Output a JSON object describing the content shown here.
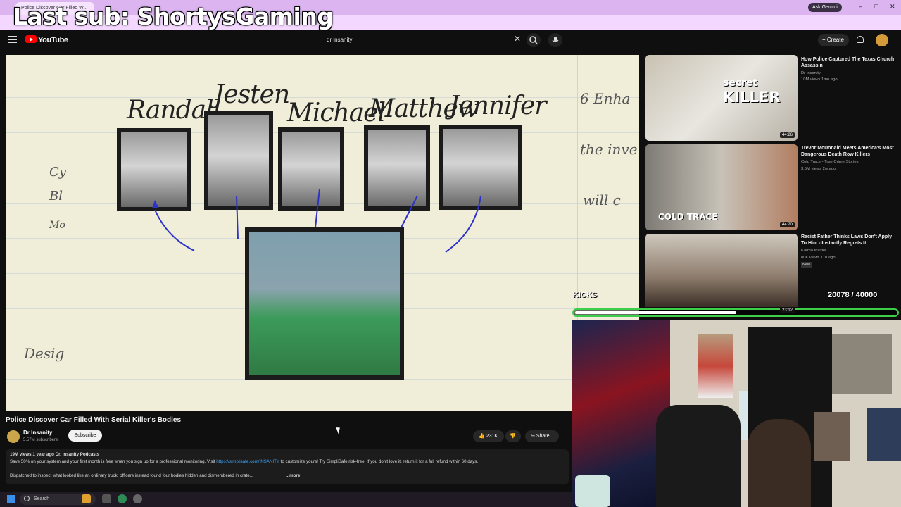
{
  "stream_overlay": {
    "last_sub": "Last sub: ShortysGaming",
    "kicks_label": "KICKS",
    "kicks_count": "20078 / 40000",
    "kicks_progress": 0.502
  },
  "browser": {
    "active_tab": "Police Discover Car Filled W...",
    "ask_gemini": "Ask Gemini"
  },
  "masthead": {
    "logo_text": "YouTube",
    "search_query": "dr insanity",
    "create_label": "Create"
  },
  "video": {
    "names": [
      "Randall",
      "Jesten",
      "Michael",
      "Matthew",
      "Jennifer"
    ],
    "side_text": [
      "6 Enha",
      "the inve",
      "will c",
      "Cy",
      "Bl",
      "Mo",
      "Desig"
    ],
    "title": "Police Discover Car Filled With Serial Killer's Bodies",
    "channel": "Dr Insanity",
    "subscribers": "5.57M subscribers",
    "subscribe_label": "Subscribe",
    "likes": "231K",
    "share_label": "Share",
    "description": {
      "stats": "19M views  1 year ago  Dr. Insanity Podcasts",
      "line1_before": "Save 50% on your system and your first month is free when you sign up for a professional monitoring. Visit ",
      "link": "https://simplisafe.com/INSANITY",
      "line1_after": " to customize yours! Try SimpliSafe risk-free. If you don't love it, return it for a full refund within 60 days.",
      "line2": "Dispatched to inspect what looked like an ordinary truck, officers instead found four bodies hidden and dismembered in crate...",
      "more": "...more"
    }
  },
  "recommendations": [
    {
      "title": "How Police Captured The Texas Church Assassin",
      "channel": "Dr Insanity",
      "meta": "10M views  1mo ago",
      "duration": "44:26",
      "thumb_text": [
        "secret",
        "KILLER"
      ]
    },
    {
      "title": "Trevor McDonald Meets America's Most Dangerous Death Row Killers",
      "channel": "Cold Trace - True Crime Stories",
      "meta": "3.5M views  2w ago",
      "duration": "44:20",
      "thumb_text": [
        "COLD TRACE"
      ]
    },
    {
      "title": "Racist Father Thinks Laws Don't Apply To Him - Instantly Regrets It",
      "channel": "Karma Insider",
      "meta": "80K views  11h ago",
      "badge": "New",
      "duration": "23:12"
    }
  ],
  "taskbar": {
    "search_label": "Search"
  },
  "colors": {
    "tabbar": "#dbb4f0",
    "kicks_border": "#3ecf4a",
    "youtube_red": "#ff0000",
    "link": "#3ea6ff"
  }
}
